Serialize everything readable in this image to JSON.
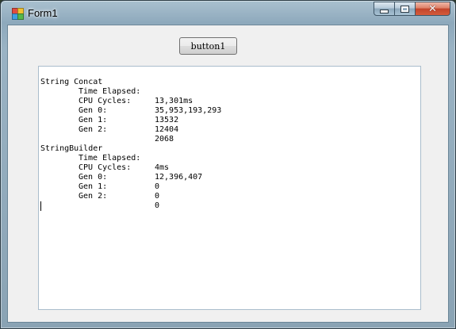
{
  "window": {
    "title": "Form1",
    "icon": "winforms-app-icon",
    "caption_icons": {
      "minimize": "minimize-icon",
      "maximize": "maximize-icon",
      "close": "close-icon"
    }
  },
  "button1": {
    "label": "button1"
  },
  "output": {
    "sections": [
      {
        "heading": "String Concat",
        "rows": [
          {
            "label": "Time Elapsed:",
            "value": "13,301ms"
          },
          {
            "label": "CPU Cycles:",
            "value": "35,953,193,293"
          },
          {
            "label": "Gen 0:",
            "value": "13532"
          },
          {
            "label": "Gen 1:",
            "value": "12404"
          },
          {
            "label": "Gen 2:",
            "value": "2068"
          }
        ]
      },
      {
        "heading": "StringBuilder",
        "rows": [
          {
            "label": "Time Elapsed:",
            "value": "4ms"
          },
          {
            "label": "CPU Cycles:",
            "value": "12,396,407"
          },
          {
            "label": "Gen 0:",
            "value": "0"
          },
          {
            "label": "Gen 1:",
            "value": "0"
          },
          {
            "label": "Gen 2:",
            "value": "0"
          }
        ]
      }
    ]
  }
}
